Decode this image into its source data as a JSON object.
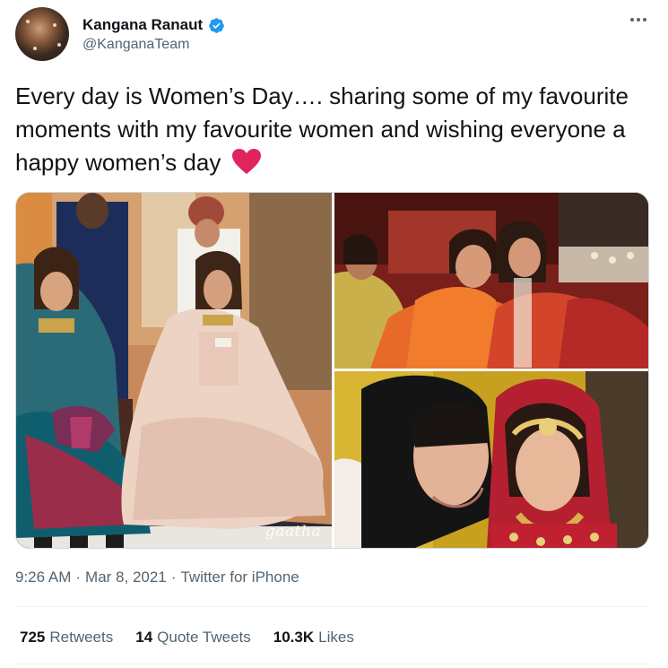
{
  "user": {
    "display_name": "Kangana Ranaut",
    "handle": "@KanganaTeam",
    "verified": true
  },
  "tweet": {
    "text": "Every day is Women’s Day…. sharing some of my favourite moments with my favourite women and wishing everyone a happy women’s day",
    "emoji": "heart-icon",
    "photos": [
      {
        "description": "bridal-group-photo",
        "watermark": "gaatha"
      },
      {
        "description": "women-celebration-photo"
      },
      {
        "description": "bridal-closeup-photo"
      }
    ]
  },
  "meta": {
    "time": "9:26 AM",
    "separator1": "·",
    "date": "Mar 8, 2021",
    "separator2": "·",
    "source": "Twitter for iPhone"
  },
  "stats": {
    "retweets_count": "725",
    "retweets_label": "Retweets",
    "quotes_count": "14",
    "quotes_label": "Quote Tweets",
    "likes_count": "10.3K",
    "likes_label": "Likes"
  },
  "colors": {
    "verified": "#1d9bf0",
    "heart": "#e0245e",
    "secondary_text": "#536471"
  }
}
